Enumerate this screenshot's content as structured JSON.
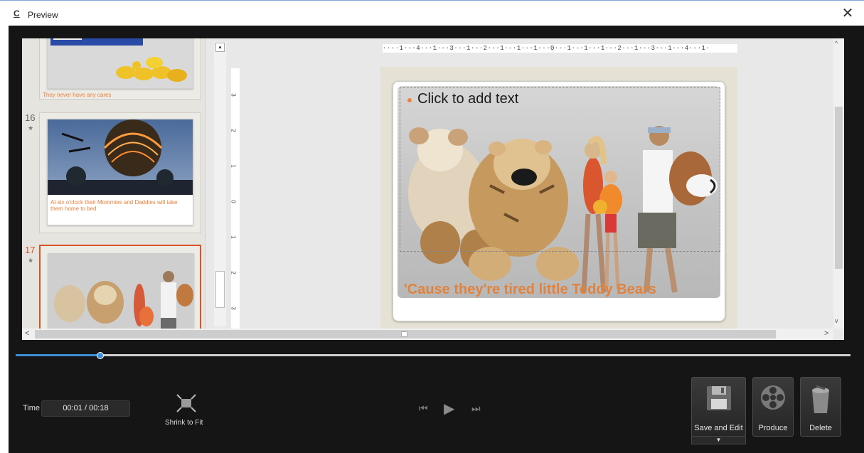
{
  "window": {
    "title": "Preview",
    "app_icon": "c-app-icon",
    "close_glyph": "✕"
  },
  "thumbnails": [
    {
      "number": "",
      "caption": "They never have any cares"
    },
    {
      "number": "16",
      "caption": "At six o'clock their Mommies and Daddies will take them home to bed"
    },
    {
      "number": "17",
      "caption": ""
    }
  ],
  "slide": {
    "placeholder_text": "Click to add text",
    "caption": "'Cause they're tired little Teddy Bears"
  },
  "ruler": {
    "horizontal": "··-·1·-·4·-·1·-·3·-·1·-·2·-·1·-·1·-·1·-·0·-·1·-·1·-·1·-·2·-·1·-·3·-·1·-·4·-·1·",
    "vertical": [
      "3",
      "2",
      "1",
      "0",
      "1",
      "2",
      "3"
    ]
  },
  "timeline": {
    "progress": 0.1
  },
  "controls": {
    "time_label": "Time",
    "time_value": "00:01  /  00:18",
    "shrink_label": "Shrink to Fit",
    "rewind_glyph": "⏮",
    "play_glyph": "▶",
    "forward_glyph": "⏭",
    "save_label": "Save and Edit",
    "save_dropdown_glyph": "▼",
    "produce_label": "Produce",
    "delete_label": "Delete"
  },
  "colors": {
    "accent": "#3b8fd8",
    "caption_orange": "#e0833f",
    "selected_border": "#d9532a"
  }
}
